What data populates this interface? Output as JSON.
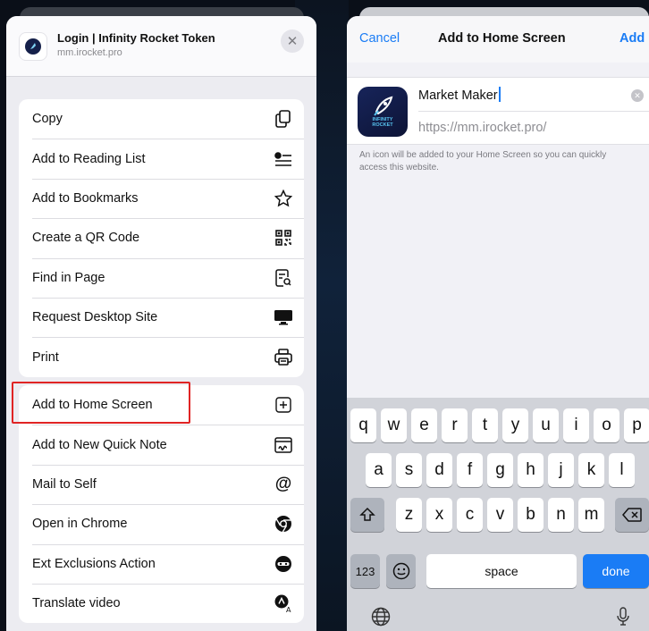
{
  "left": {
    "site_title": "Login | Infinity Rocket Token",
    "site_url": "mm.irocket.pro",
    "close_icon": "close-icon",
    "groups": [
      [
        {
          "label": "Copy",
          "icon": "copy-icon"
        },
        {
          "label": "Add to Reading List",
          "icon": "reading-list-icon"
        },
        {
          "label": "Add to Bookmarks",
          "icon": "star-icon"
        },
        {
          "label": "Create a QR Code",
          "icon": "qr-code-icon"
        },
        {
          "label": "Find in Page",
          "icon": "find-in-page-icon"
        },
        {
          "label": "Request Desktop Site",
          "icon": "desktop-icon"
        },
        {
          "label": "Print",
          "icon": "printer-icon"
        }
      ],
      [
        {
          "label": "Add to Home Screen",
          "icon": "add-square-icon"
        },
        {
          "label": "Add to New Quick Note",
          "icon": "quick-note-icon"
        },
        {
          "label": "Mail to Self",
          "icon": "at-sign-icon"
        },
        {
          "label": "Open in Chrome",
          "icon": "chrome-icon"
        },
        {
          "label": "Ext Exclusions Action",
          "icon": "mask-icon"
        },
        {
          "label": "Translate video",
          "icon": "translate-icon"
        }
      ]
    ],
    "highlight_color": "#e02424"
  },
  "right": {
    "cancel": "Cancel",
    "title": "Add to Home Screen",
    "add": "Add",
    "name_value": "Market Maker",
    "url_value": "https://mm.irocket.pro/",
    "hint": "An icon will be added to your Home Screen so you can quickly access this website.",
    "app_icon_text_1": "INFINITY",
    "app_icon_text_2": "ROCKET",
    "keyboard": {
      "row1": [
        "q",
        "w",
        "e",
        "r",
        "t",
        "y",
        "u",
        "i",
        "o",
        "p"
      ],
      "row2": [
        "a",
        "s",
        "d",
        "f",
        "g",
        "h",
        "j",
        "k",
        "l"
      ],
      "row3": [
        "z",
        "x",
        "c",
        "v",
        "b",
        "n",
        "m"
      ],
      "numbers": "123",
      "space": "space",
      "done": "done"
    },
    "accent_color": "#1a7cf5"
  }
}
